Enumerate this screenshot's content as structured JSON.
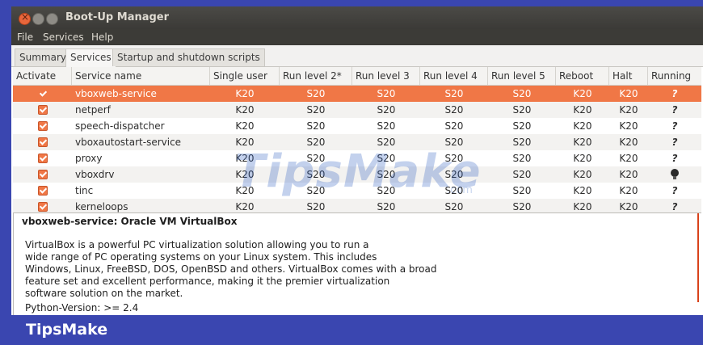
{
  "window": {
    "title": "Boot-Up Manager"
  },
  "menu": [
    "File",
    "Services",
    "Help"
  ],
  "tabs": [
    "Summary",
    "Services",
    "Startup and shutdown scripts"
  ],
  "table": {
    "headers": [
      "Activate",
      "Service name",
      "Single user",
      "Run level 2*",
      "Run level 3",
      "Run level 4",
      "Run level 5",
      "Reboot",
      "Halt",
      "Running"
    ],
    "rows": [
      {
        "name": "vboxweb-service",
        "single": "K20",
        "rl2": "S20",
        "rl3": "S20",
        "rl4": "S20",
        "rl5": "S20",
        "reboot": "K20",
        "halt": "K20",
        "running": "?"
      },
      {
        "name": "netperf",
        "single": "K20",
        "rl2": "S20",
        "rl3": "S20",
        "rl4": "S20",
        "rl5": "S20",
        "reboot": "K20",
        "halt": "K20",
        "running": "?"
      },
      {
        "name": "speech-dispatcher",
        "single": "K20",
        "rl2": "S20",
        "rl3": "S20",
        "rl4": "S20",
        "rl5": "S20",
        "reboot": "K20",
        "halt": "K20",
        "running": "?"
      },
      {
        "name": "vboxautostart-service",
        "single": "K20",
        "rl2": "S20",
        "rl3": "S20",
        "rl4": "S20",
        "rl5": "S20",
        "reboot": "K20",
        "halt": "K20",
        "running": "?"
      },
      {
        "name": "proxy",
        "single": "K20",
        "rl2": "S20",
        "rl3": "S20",
        "rl4": "S20",
        "rl5": "S20",
        "reboot": "K20",
        "halt": "K20",
        "running": "?"
      },
      {
        "name": "vboxdrv",
        "single": "K20",
        "rl2": "S20",
        "rl3": "S20",
        "rl4": "S20",
        "rl5": "S20",
        "reboot": "K20",
        "halt": "K20",
        "running": "bulb-icon"
      },
      {
        "name": "tinc",
        "single": "K20",
        "rl2": "S20",
        "rl3": "S20",
        "rl4": "S20",
        "rl5": "S20",
        "reboot": "K20",
        "halt": "K20",
        "running": "?"
      },
      {
        "name": "kerneloops",
        "single": "K20",
        "rl2": "S20",
        "rl3": "S20",
        "rl4": "S20",
        "rl5": "S20",
        "reboot": "K20",
        "halt": "K20",
        "running": "?"
      }
    ]
  },
  "description": {
    "title": "vboxweb-service:  Oracle VM VirtualBox",
    "lines": [
      "VirtualBox is a powerful PC virtualization solution allowing you to run a",
      "wide range of PC operating systems on your Linux system. This includes",
      "Windows, Linux, FreeBSD, DOS, OpenBSD and others. VirtualBox comes with a broad",
      "feature set and excellent performance, making it the premier virtualization",
      "software solution on the market."
    ],
    "python_version": "Python-Version: >= 2.4"
  },
  "footer": "TipsMake",
  "watermark": {
    "main": "TipsMake",
    "sub": ".com"
  },
  "colors": {
    "selection": "#f07746",
    "frame": "#3a46b0",
    "titlebar": "#3c3b37"
  }
}
